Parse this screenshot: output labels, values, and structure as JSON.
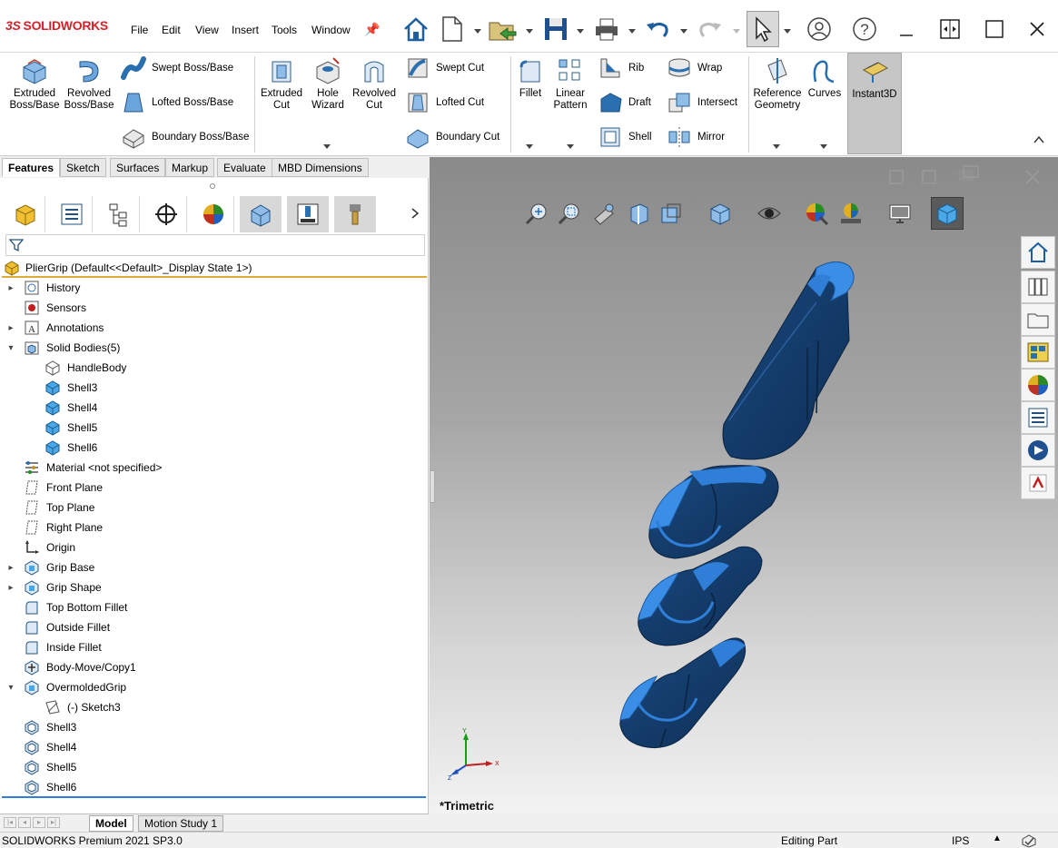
{
  "app": {
    "logo_text": "SOLIDWORKS",
    "logo_mark": "3S"
  },
  "menu": [
    "File",
    "Edit",
    "View",
    "Insert",
    "Tools",
    "Window"
  ],
  "ribbon": {
    "extruded_boss": "Extruded Boss/Base",
    "revolved_boss": "Revolved Boss/Base",
    "swept_boss": "Swept Boss/Base",
    "lofted_boss": "Lofted Boss/Base",
    "boundary_boss": "Boundary Boss/Base",
    "extruded_cut": "Extruded Cut",
    "hole_wizard": "Hole Wizard",
    "revolved_cut": "Revolved Cut",
    "swept_cut": "Swept Cut",
    "lofted_cut": "Lofted Cut",
    "boundary_cut": "Boundary Cut",
    "fillet": "Fillet",
    "linear_pattern": "Linear Pattern",
    "rib": "Rib",
    "draft": "Draft",
    "shell": "Shell",
    "wrap": "Wrap",
    "intersect": "Intersect",
    "mirror": "Mirror",
    "reference_geometry": "Reference Geometry",
    "curves": "Curves",
    "instant3d": "Instant3D"
  },
  "command_tabs": [
    "Features",
    "Sketch",
    "Surfaces",
    "Markup",
    "Evaluate",
    "MBD Dimensions"
  ],
  "active_tab": "Features",
  "tree": {
    "root": "PlierGrip  (Default<<Default>_Display State 1>)",
    "items": [
      {
        "label": "History",
        "expand": "▸"
      },
      {
        "label": "Sensors",
        "expand": ""
      },
      {
        "label": "Annotations",
        "expand": "▸"
      },
      {
        "label": "Solid Bodies(5)",
        "expand": "▾"
      },
      {
        "label": "HandleBody",
        "expand": ""
      },
      {
        "label": "Shell3",
        "expand": ""
      },
      {
        "label": "Shell4",
        "expand": ""
      },
      {
        "label": "Shell5",
        "expand": ""
      },
      {
        "label": "Shell6",
        "expand": ""
      },
      {
        "label": "Material <not specified>",
        "expand": ""
      },
      {
        "label": "Front Plane",
        "expand": ""
      },
      {
        "label": "Top Plane",
        "expand": ""
      },
      {
        "label": "Right Plane",
        "expand": ""
      },
      {
        "label": "Origin",
        "expand": ""
      },
      {
        "label": "Grip Base",
        "expand": "▸"
      },
      {
        "label": "Grip Shape",
        "expand": "▸"
      },
      {
        "label": "Top Bottom Fillet",
        "expand": ""
      },
      {
        "label": "Outside Fillet",
        "expand": ""
      },
      {
        "label": "Inside Fillet",
        "expand": ""
      },
      {
        "label": "Body-Move/Copy1",
        "expand": ""
      },
      {
        "label": "OvermoldedGrip",
        "expand": "▾"
      },
      {
        "label": "(-) Sketch3",
        "expand": ""
      },
      {
        "label": "Shell3",
        "expand": ""
      },
      {
        "label": "Shell4",
        "expand": ""
      },
      {
        "label": "Shell5",
        "expand": ""
      },
      {
        "label": "Shell6",
        "expand": ""
      }
    ]
  },
  "bottom_tabs": [
    "Model",
    "Motion Study 1"
  ],
  "viewport": {
    "view_name": "*Trimetric",
    "axis_labels": [
      "Y",
      "X",
      "Z"
    ]
  },
  "status": {
    "product": "SOLIDWORKS Premium 2021 SP3.0",
    "mode": "Editing Part",
    "units": "IPS"
  },
  "colors": {
    "body_dark": "#163d6b",
    "body_edge": "#2f7fd9",
    "accent_orange": "#e0a93a"
  }
}
